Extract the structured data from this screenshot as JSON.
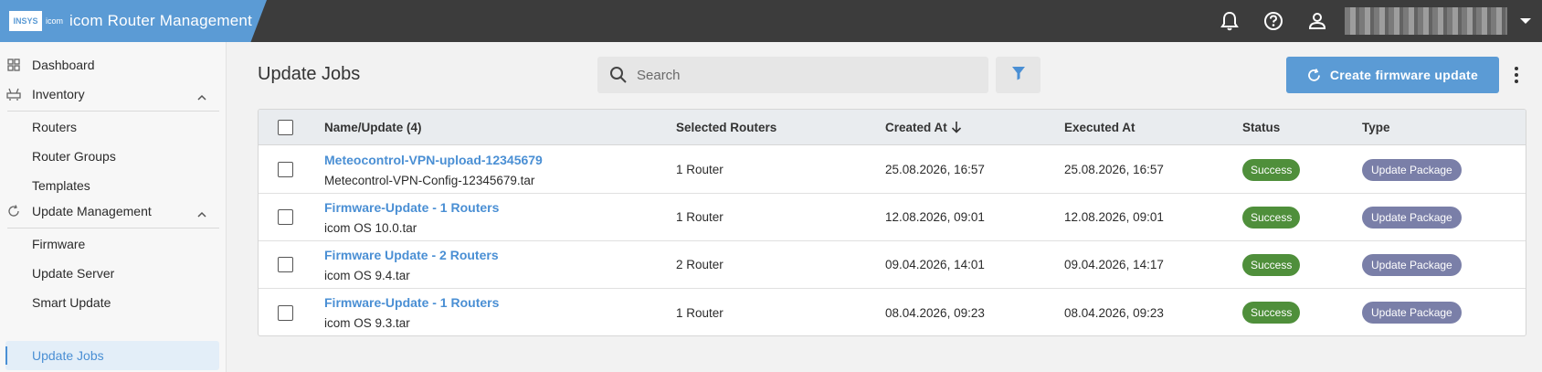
{
  "app": {
    "logo_a": "INSYS",
    "logo_b": "icom",
    "title": "icom Router Management"
  },
  "sidebar": {
    "dashboard": "Dashboard",
    "inventory": "Inventory",
    "routers": "Routers",
    "router_groups": "Router Groups",
    "templates": "Templates",
    "update_management": "Update Management",
    "firmware": "Firmware",
    "update_server": "Update Server",
    "smart_update": "Smart Update",
    "update_jobs": "Update Jobs"
  },
  "main": {
    "title": "Update Jobs",
    "search_placeholder": "Search",
    "create_label": "Create firmware update"
  },
  "table": {
    "headers": {
      "name": "Name/Update (4)",
      "selected": "Selected Routers",
      "created": "Created At",
      "executed": "Executed At",
      "status": "Status",
      "type": "Type"
    },
    "rows": [
      {
        "name": "Meteocontrol-VPN-upload-12345679",
        "file": "Metecontrol-VPN-Config-12345679.tar",
        "selected": "1 Router",
        "created": "25.08.2026, 16:57",
        "executed": "25.08.2026, 16:57",
        "status": "Success",
        "type": "Update Package"
      },
      {
        "name": "Firmware-Update - 1 Routers",
        "file": "icom OS 10.0.tar",
        "selected": "1 Router",
        "created": "12.08.2026, 09:01",
        "executed": "12.08.2026, 09:01",
        "status": "Success",
        "type": "Update Package"
      },
      {
        "name": "Firmware Update - 2 Routers",
        "file": "icom OS 9.4.tar",
        "selected": "2 Router",
        "created": "09.04.2026, 14:01",
        "executed": "09.04.2026, 14:17",
        "status": "Success",
        "type": "Update Package"
      },
      {
        "name": "Firmware-Update - 1 Routers",
        "file": "icom OS 9.3.tar",
        "selected": "1 Router",
        "created": "08.04.2026, 09:23",
        "executed": "08.04.2026, 09:23",
        "status": "Success",
        "type": "Update Package"
      }
    ]
  },
  "icons": {
    "bell": "bell-icon",
    "help": "help-icon",
    "user": "user-icon",
    "search": "search-icon",
    "filter": "filter-icon",
    "refresh": "refresh-icon",
    "more": "more-vertical-icon"
  },
  "colors": {
    "brand": "#5b9bd5",
    "topbar": "#3c3c3c",
    "link": "#4a8fd4",
    "success": "#4f8f3b",
    "type_badge": "#7a7fa8"
  }
}
